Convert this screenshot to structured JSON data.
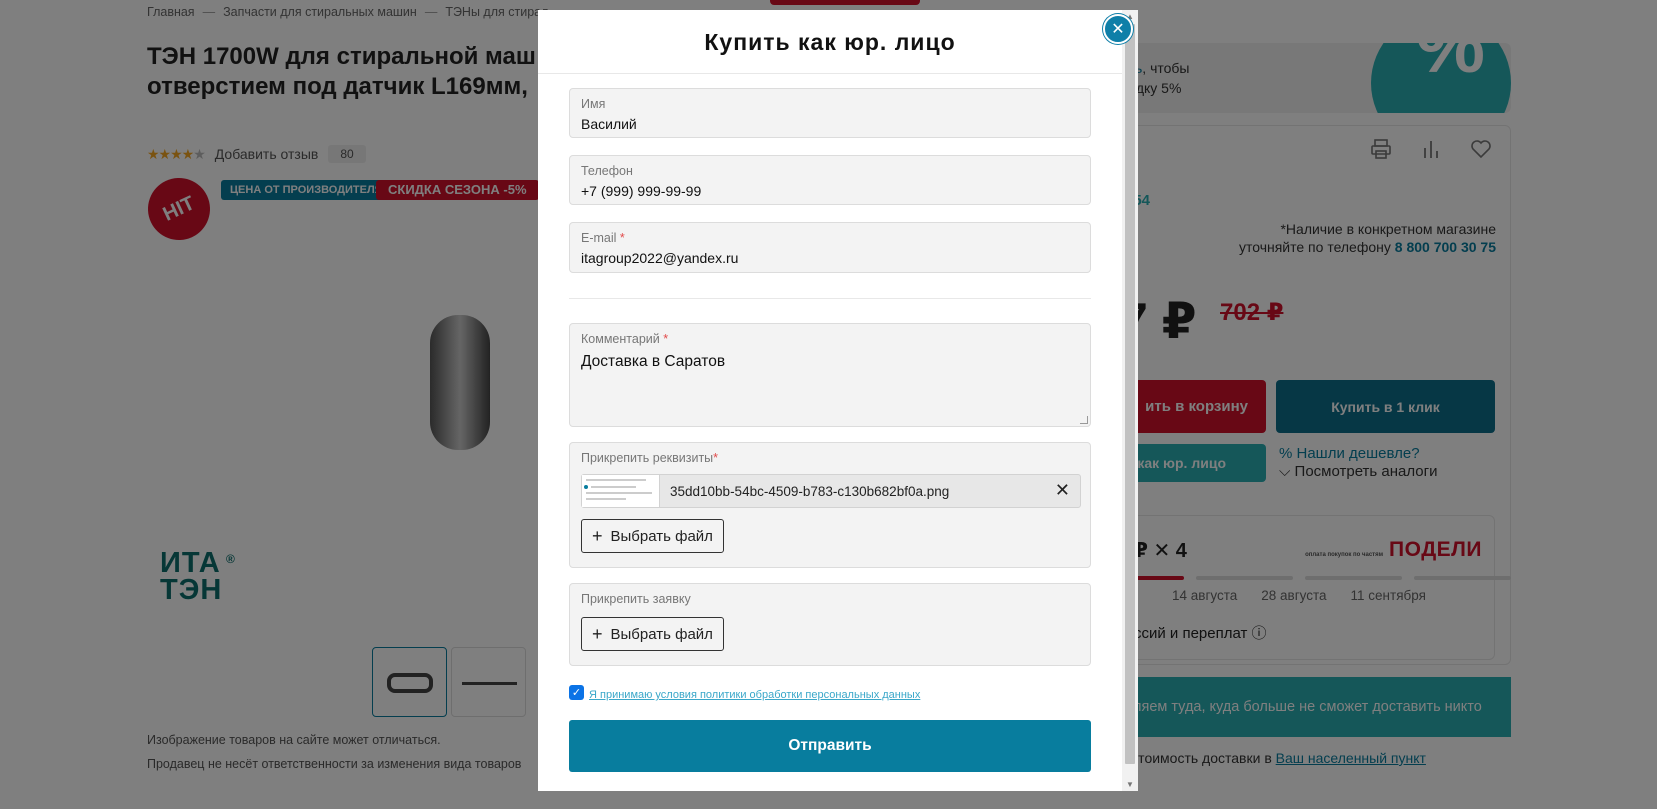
{
  "page": {
    "breadcrumbs": [
      "Главная",
      "—",
      "Запчасти для стиральных машин",
      "—",
      "ТЭНы для стирал..."
    ],
    "title_line1": "ТЭН 1700W для стиральной маш",
    "title_line2": "отверстием под датчик L169мм,",
    "stars_on": "★★★★",
    "stars_off": "★",
    "add_review": "Добавить отзыв",
    "review_count": "80",
    "hit": "HIT",
    "badge_manufacturer": "ЦЕНА ОТ ПРОИЗВОДИТЕЛЯ",
    "badge_season": "СКИДКА СЕЗОНА -5%",
    "logo_line1": "ИТА",
    "logo_line2": "ТЭН",
    "logo_reg": "®",
    "note1": "Изображение товаров на сайте может отличаться.",
    "note2": "Продавец не несёт ответственности за изменения вида товаров",
    "promo_link": "сь",
    "promo_text1": ", чтобы",
    "promo_text2": "идку 5%",
    "promo_pct": "%",
    "code": "054",
    "avail_line1": "*Наличие в конкретном магазине",
    "avail_line2": "уточняйте по телефону",
    "phone": "8 800 700 30 75",
    "price": "7 ₽",
    "old_price": "702 ₽",
    "cart_label": "ить в корзину",
    "one_click_label": "Купить в 1 клик",
    "jur_label": "как юр. лицо",
    "cheaper_label": "% Нашли дешевле?",
    "analogs_label": "⌵ Посмотреть аналоги",
    "podeli_parts": "₽ ✕ 4",
    "podeli_small": "оплата покупок по частям",
    "podeli_brand": "ПОДЕЛИ",
    "podeli_dates": [
      "14 августа",
      "28 августа",
      "11 сентября"
    ],
    "podeli_fees": "ссий и переплат ⓘ",
    "teal_text": "ляем туда, куда больше не сможет доставить никто",
    "deliv_text": "ь стоимость доставки в",
    "deliv_link": "Ваш населенный пункт"
  },
  "modal": {
    "title": "Купить как юр. лицо",
    "close_glyph": "✕",
    "fields": {
      "name": {
        "label": "Имя",
        "value": "Василий"
      },
      "phone": {
        "label": "Телефон",
        "value": "+7 (999) 999-99-99"
      },
      "email": {
        "label": "E-mail",
        "required": "*",
        "value": "itagroup2022@yandex.ru"
      },
      "comment": {
        "label": "Комментарий",
        "required": "*",
        "value": "Доставка в Саратов"
      }
    },
    "requisites": {
      "label": "Прикрепить реквизиты",
      "required": "*",
      "file_name": "35dd10bb-54bc-4509-b783-c130b682bf0a.png",
      "remove_glyph": "✕",
      "choose_label": "Выбрать файл"
    },
    "request": {
      "label": "Прикрепить заявку",
      "choose_label": "Выбрать файл"
    },
    "agree_text": "Я принимаю условия политики обработки персональных данных",
    "agree_checked": true,
    "submit_label": "Отправить"
  },
  "colors": {
    "accent": "#087d9e",
    "accent_light": "#2aaeb3",
    "red": "#d0102b",
    "overlay": "rgba(0,0,0,0.5)"
  },
  "icons": [
    "close-icon",
    "plus-icon",
    "print-icon",
    "compare-icon",
    "heart-icon",
    "check-icon"
  ]
}
